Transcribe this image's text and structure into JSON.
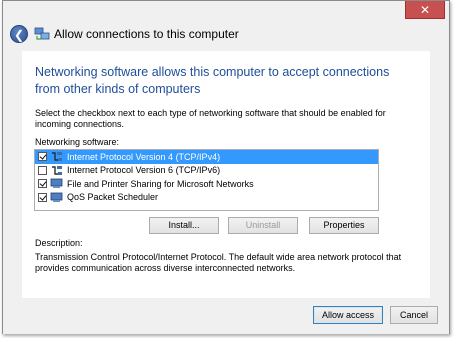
{
  "window": {
    "title": "Allow connections to this computer",
    "close_glyph": "✕",
    "back_glyph": "❮"
  },
  "main": {
    "heading": "Networking software allows this computer to accept connections from other kinds of computers",
    "instructions": "Select the checkbox next to each type of networking software that should be enabled for incoming connections.",
    "list_label": "Networking software:",
    "items": [
      {
        "label": "Internet Protocol Version 4 (TCP/IPv4)",
        "checked": true,
        "selected": true,
        "icon": "protocol-icon"
      },
      {
        "label": "Internet Protocol Version 6 (TCP/IPv6)",
        "checked": false,
        "selected": false,
        "icon": "protocol-icon"
      },
      {
        "label": "File and Printer Sharing for Microsoft Networks",
        "checked": true,
        "selected": false,
        "icon": "network-service-icon"
      },
      {
        "label": "QoS Packet Scheduler",
        "checked": true,
        "selected": false,
        "icon": "network-service-icon"
      }
    ],
    "install_label": "Install...",
    "uninstall_label": "Uninstall",
    "properties_label": "Properties",
    "description_label": "Description:",
    "description_text": "Transmission Control Protocol/Internet Protocol. The default wide area network protocol that provides communication across diverse interconnected networks."
  },
  "footer": {
    "allow_label": "Allow access",
    "cancel_label": "Cancel"
  },
  "colors": {
    "heading": "#1e4e9a",
    "selection": "#3399ff",
    "close": "#c75050"
  }
}
